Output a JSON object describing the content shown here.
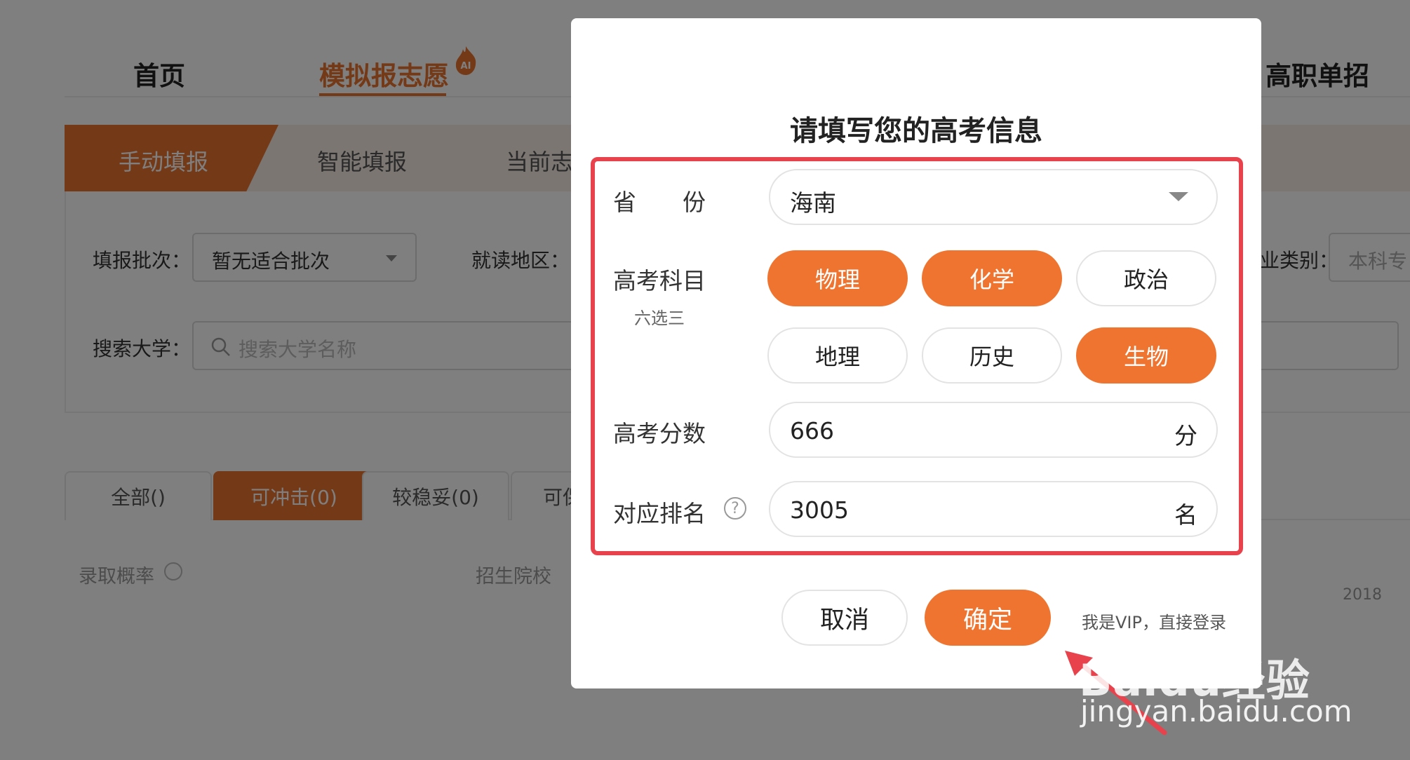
{
  "nav": {
    "items": [
      "首页",
      "模拟报志愿",
      "高职单招"
    ],
    "ai_badge": "AI"
  },
  "modes": [
    "手动填报",
    "智能填报",
    "当前志"
  ],
  "filters": {
    "batch_label": "填报批次：",
    "batch_value": "暂无适合批次",
    "region_label": "就读地区：",
    "type_label": "业类别：",
    "type_value": "本科专",
    "search_label": "搜索大学：",
    "search_placeholder": "搜索大学名称"
  },
  "result_tabs": [
    "全部()",
    "可冲击(0)",
    "较稳妥(0)",
    "可保"
  ],
  "columns": [
    "录取概率",
    "招生院校",
    "2018"
  ],
  "dialog": {
    "title": "请填写您的高考信息",
    "province_label": "省　　份",
    "province_value": "海南",
    "subjects_label": "高考科目",
    "subjects_hint": "六选三",
    "subjects": [
      {
        "name": "物理",
        "selected": true
      },
      {
        "name": "化学",
        "selected": true
      },
      {
        "name": "政治",
        "selected": false
      },
      {
        "name": "地理",
        "selected": false
      },
      {
        "name": "历史",
        "selected": false
      },
      {
        "name": "生物",
        "selected": true
      }
    ],
    "score_label": "高考分数",
    "score_value": "666",
    "score_unit": "分",
    "rank_label": "对应排名",
    "rank_help": "?",
    "rank_value": "3005",
    "rank_unit": "名",
    "cancel_label": "取消",
    "confirm_label": "确定",
    "vip_link": "我是VIP，直接登录"
  },
  "watermark": {
    "line1": "Baidu经验",
    "line2": "jingyan.baidu.com"
  },
  "colors": {
    "accent": "#ef742f",
    "highlight": "#e8434d"
  }
}
